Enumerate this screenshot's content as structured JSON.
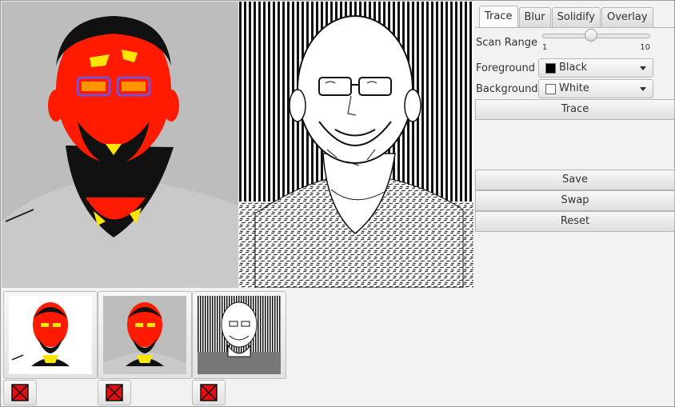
{
  "tabs": [
    {
      "label": "Trace",
      "active": true
    },
    {
      "label": "Blur",
      "active": false
    },
    {
      "label": "Solidify",
      "active": false
    },
    {
      "label": "Overlay",
      "active": false
    }
  ],
  "scan_range": {
    "label": "Scan Range",
    "min_label": "1",
    "max_label": "10",
    "value": 5
  },
  "foreground": {
    "label": "Foreground",
    "value": "Black",
    "swatch": "#000000"
  },
  "background": {
    "label": "Background",
    "value": "White",
    "swatch": "#ffffff"
  },
  "buttons": {
    "trace": "Trace",
    "save": "Save",
    "swap": "Swap",
    "reset": "Reset"
  },
  "colors": {
    "posterize_red": "#ff1a00",
    "posterize_yellow": "#ffe600",
    "shirt_gray": "#c8c8c8",
    "bg_gray": "#bdbdbd",
    "delete_red": "#e01010"
  },
  "thumbnails": [
    {
      "name": "posterized-white-bg"
    },
    {
      "name": "posterized-gray-bg"
    },
    {
      "name": "traced-edges"
    }
  ]
}
